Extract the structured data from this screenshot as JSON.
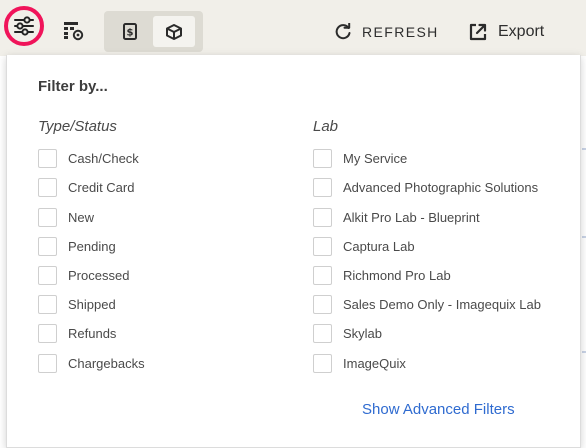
{
  "toolbar": {
    "refresh_label": "REFRESH",
    "export_label": "Export",
    "filter_icon": "sliders-icon",
    "accent_color": "#f0145a"
  },
  "filter_panel": {
    "title": "Filter by...",
    "type_status": {
      "heading": "Type/Status",
      "options": [
        "Cash/Check",
        "Credit Card",
        "New",
        "Pending",
        "Processed",
        "Shipped",
        "Refunds",
        "Chargebacks"
      ]
    },
    "lab": {
      "heading": "Lab",
      "options": [
        "My Service",
        "Advanced Photographic Solutions",
        "Alkit Pro Lab - Blueprint",
        "Captura Lab",
        "Richmond Pro Lab",
        "Sales Demo Only - Imagequix Lab",
        "Skylab",
        "ImageQuix"
      ]
    },
    "advanced_link": "Show Advanced Filters",
    "link_color": "#2f6bd0"
  }
}
